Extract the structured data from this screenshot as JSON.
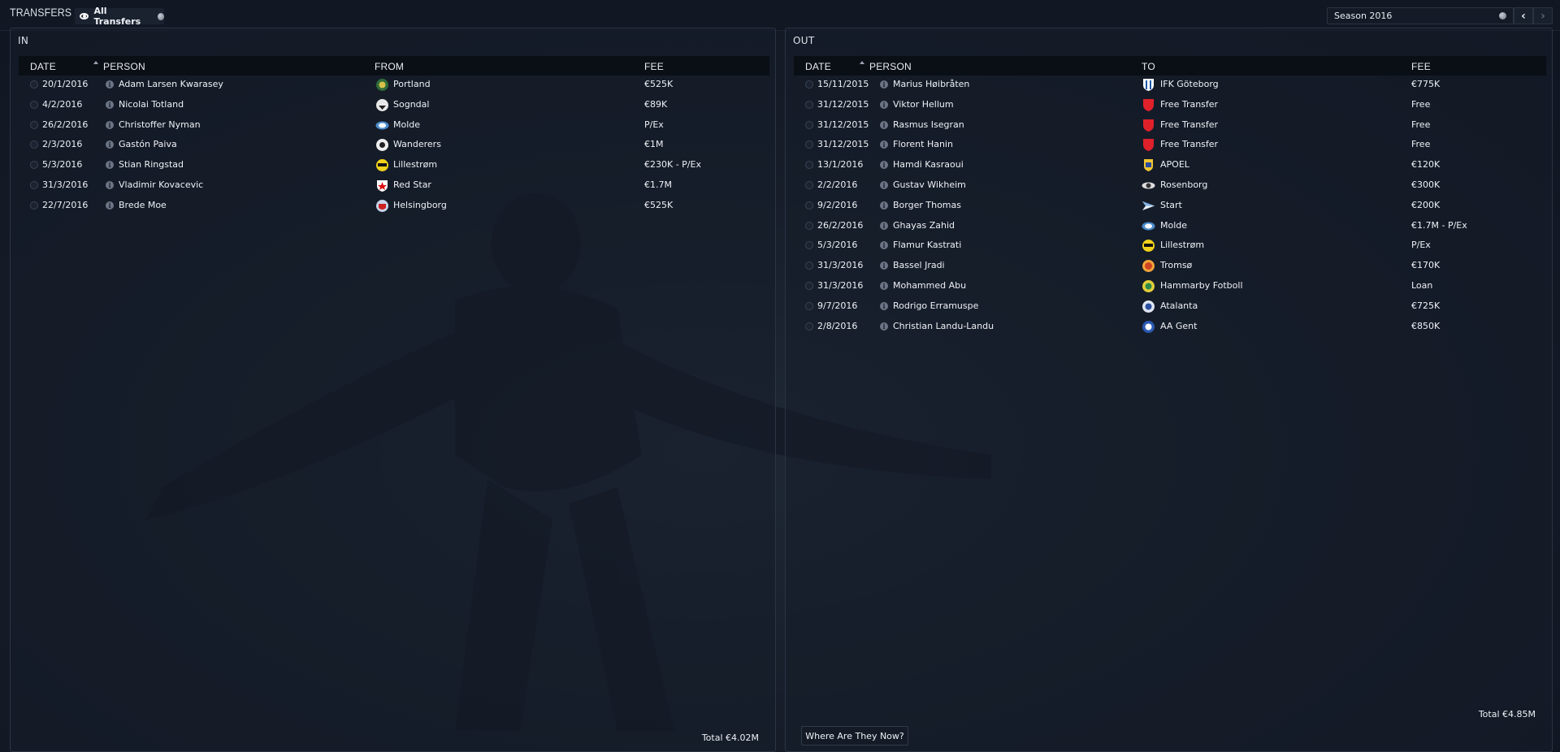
{
  "page": {
    "title": "TRANSFERS",
    "filter_label": "All Transfers"
  },
  "season": {
    "label": "Season 2016"
  },
  "in_panel": {
    "title": "IN",
    "headers": {
      "date": "DATE",
      "person": "PERSON",
      "club": "FROM",
      "fee": "FEE"
    },
    "rows": [
      {
        "date": "20/1/2016",
        "person": "Adam Larsen Kwarasey",
        "club": "Portland",
        "fee": "€525K",
        "badge": "portland-badge"
      },
      {
        "date": "4/2/2016",
        "person": "Nicolai Totland",
        "club": "Sogndal",
        "fee": "€89K",
        "badge": "sogndal-badge"
      },
      {
        "date": "26/2/2016",
        "person": "Christoffer Nyman",
        "club": "Molde",
        "fee": "P/Ex",
        "badge": "molde-badge"
      },
      {
        "date": "2/3/2016",
        "person": "Gastón Paiva",
        "club": "Wanderers",
        "fee": "€1M",
        "badge": "wanderers-badge"
      },
      {
        "date": "5/3/2016",
        "person": "Stian Ringstad",
        "club": "Lillestrøm",
        "fee": "€230K - P/Ex",
        "badge": "lillestrom-badge"
      },
      {
        "date": "31/3/2016",
        "person": "Vladimir Kovacevic",
        "club": "Red Star",
        "fee": "€1.7M",
        "badge": "red-star-badge"
      },
      {
        "date": "22/7/2016",
        "person": "Brede Moe",
        "club": "Helsingborg",
        "fee": "€525K",
        "badge": "helsingborg-badge"
      }
    ],
    "total": "Total €4.02M"
  },
  "out_panel": {
    "title": "OUT",
    "headers": {
      "date": "DATE",
      "person": "PERSON",
      "club": "TO",
      "fee": "FEE"
    },
    "rows": [
      {
        "date": "15/11/2015",
        "person": "Marius Høibråten",
        "club": "IFK Göteborg",
        "fee": "€775K",
        "badge": "ifk-goteborg-badge"
      },
      {
        "date": "31/12/2015",
        "person": "Viktor Hellum",
        "club": "Free Transfer",
        "fee": "Free",
        "badge": "free-transfer-badge"
      },
      {
        "date": "31/12/2015",
        "person": "Rasmus Isegran",
        "club": "Free Transfer",
        "fee": "Free",
        "badge": "free-transfer-badge"
      },
      {
        "date": "31/12/2015",
        "person": "Florent Hanin",
        "club": "Free Transfer",
        "fee": "Free",
        "badge": "free-transfer-badge"
      },
      {
        "date": "13/1/2016",
        "person": "Hamdi Kasraoui",
        "club": "APOEL",
        "fee": "€120K",
        "badge": "apoel-badge"
      },
      {
        "date": "2/2/2016",
        "person": "Gustav Wikheim",
        "club": "Rosenborg",
        "fee": "€300K",
        "badge": "rosenborg-badge"
      },
      {
        "date": "9/2/2016",
        "person": "Borger Thomas",
        "club": "Start",
        "fee": "€200K",
        "badge": "start-badge"
      },
      {
        "date": "26/2/2016",
        "person": "Ghayas Zahid",
        "club": "Molde",
        "fee": "€1.7M - P/Ex",
        "badge": "molde-badge"
      },
      {
        "date": "5/3/2016",
        "person": "Flamur Kastrati",
        "club": "Lillestrøm",
        "fee": "P/Ex",
        "badge": "lillestrom-badge"
      },
      {
        "date": "31/3/2016",
        "person": "Bassel Jradi",
        "club": "Tromsø",
        "fee": "€170K",
        "badge": "tromso-badge"
      },
      {
        "date": "31/3/2016",
        "person": "Mohammed Abu",
        "club": "Hammarby Fotboll",
        "fee": "Loan",
        "badge": "hammarby-badge"
      },
      {
        "date": "9/7/2016",
        "person": "Rodrigo Erramuspe",
        "club": "Atalanta",
        "fee": "€725K",
        "badge": "atalanta-badge"
      },
      {
        "date": "2/8/2016",
        "person": "Christian Landu-Landu",
        "club": "AA Gent",
        "fee": "€850K",
        "badge": "aa-gent-badge"
      }
    ],
    "total": "Total €4.85M"
  },
  "footer": {
    "where_button": "Where Are They Now?"
  },
  "colors": {
    "background": "#161d29",
    "header_row": "#0a0e15",
    "text": "#eef1f5",
    "free_transfer_shield": "#e0212b"
  }
}
